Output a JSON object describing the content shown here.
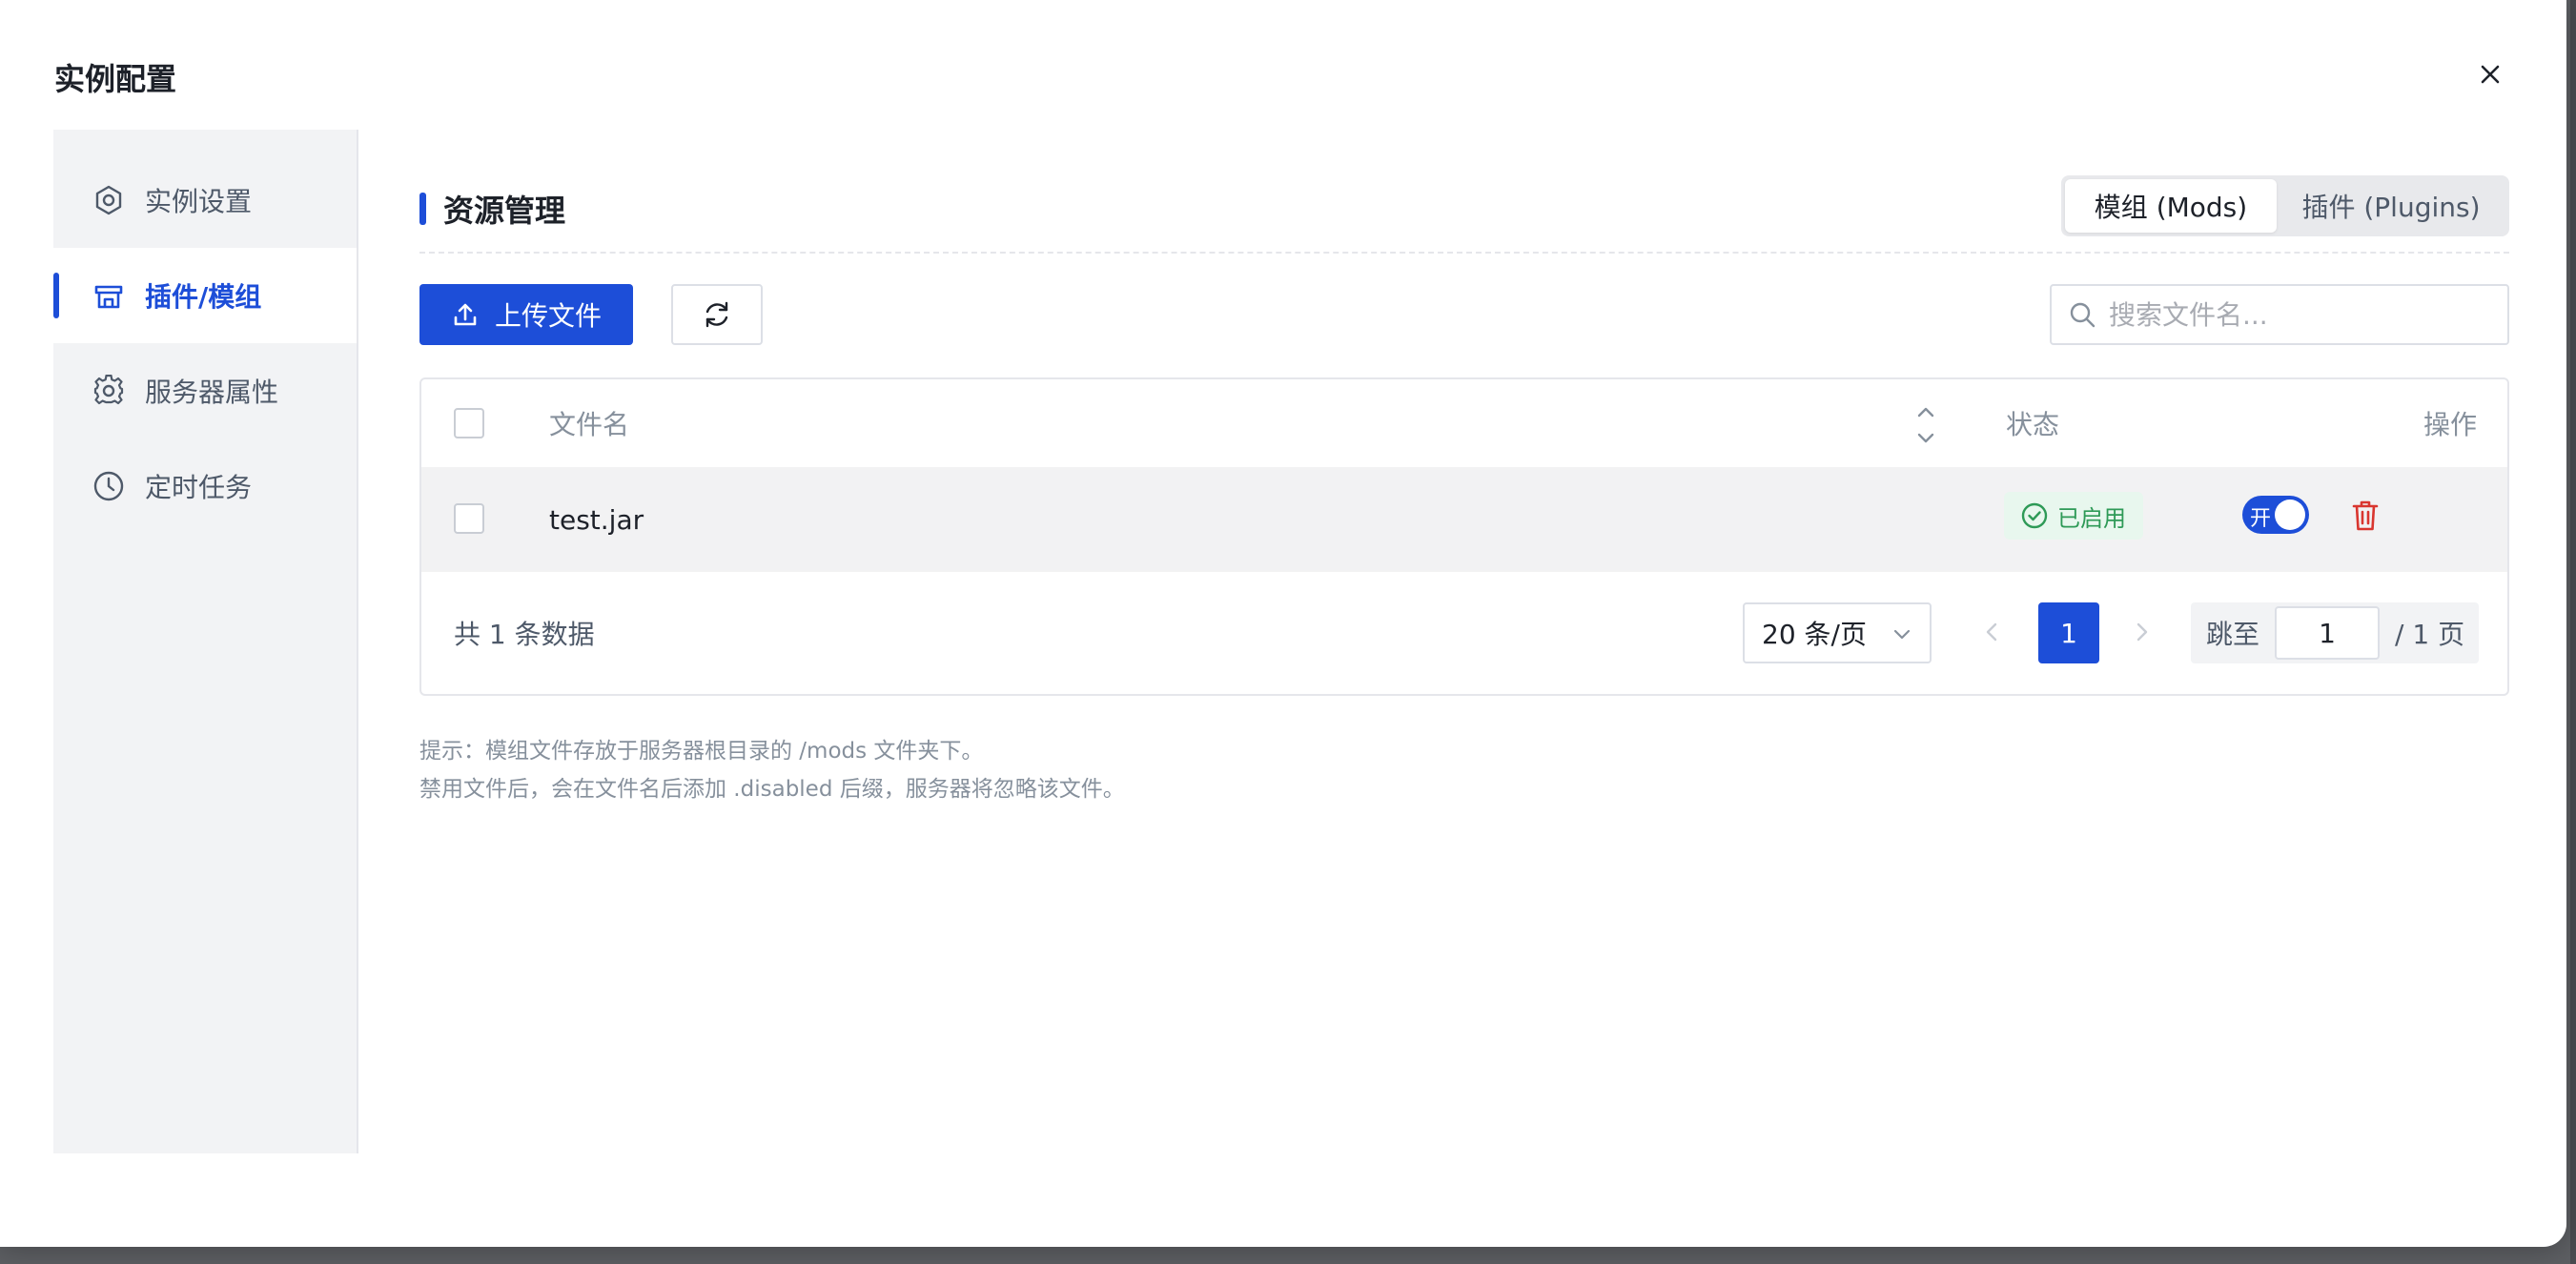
{
  "modal": {
    "title": "实例配置"
  },
  "sidebar": {
    "items": [
      {
        "label": "实例设置",
        "icon": "hexagon-settings-icon"
      },
      {
        "label": "插件/模组",
        "icon": "store-icon",
        "active": true
      },
      {
        "label": "服务器属性",
        "icon": "gear-icon"
      },
      {
        "label": "定时任务",
        "icon": "clock-icon"
      }
    ]
  },
  "section": {
    "title": "资源管理"
  },
  "segmented": {
    "mods": "模组 (Mods)",
    "plugins": "插件 (Plugins)",
    "selected": "mods"
  },
  "toolbar": {
    "upload_label": "上传文件",
    "search_placeholder": "搜索文件名..."
  },
  "table": {
    "headers": {
      "filename": "文件名",
      "status": "状态",
      "actions": "操作"
    },
    "rows": [
      {
        "filename": "test.jar",
        "status": "已启用",
        "switch_label": "开",
        "enabled": true
      }
    ]
  },
  "pagination": {
    "total_text": "共 1 条数据",
    "page_size": "20 条/页",
    "current_page": "1",
    "jump_label": "跳至",
    "jump_value": "1",
    "total_pages_text": "/ 1 页"
  },
  "tips": {
    "line1": "提示：模组文件存放于服务器根目录的 /mods 文件夹下。",
    "line2": "禁用文件后，会在文件名后添加 .disabled 后缀，服务器将忽略该文件。"
  },
  "colors": {
    "primary": "#1d4ed8",
    "success": "#2e9a57",
    "danger": "#d9362f"
  }
}
